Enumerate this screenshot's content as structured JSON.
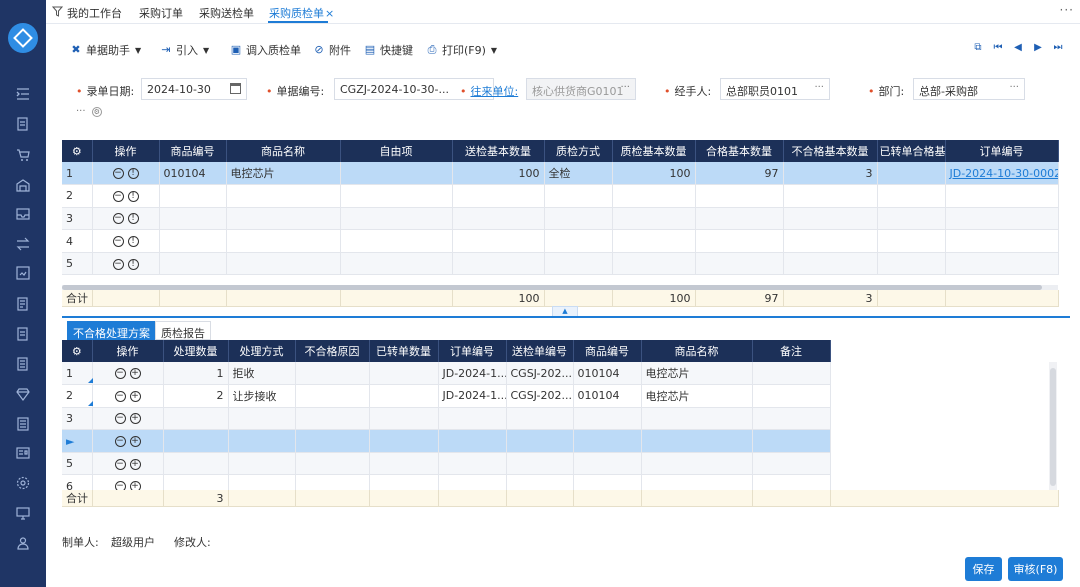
{
  "tabs": [
    {
      "label": "我的工作台"
    },
    {
      "label": "采购订单"
    },
    {
      "label": "采购送检单"
    },
    {
      "label": "采购质检单"
    }
  ],
  "tab_close": "×",
  "more": "···",
  "toolbar": {
    "assistant": "单据助手",
    "import": "引入",
    "import_qc": "调入质检单",
    "attachment": "附件",
    "shortcut": "快捷键",
    "print": "打印(F9)"
  },
  "form": {
    "entry_date_label": "录单日期:",
    "entry_date": "2024-10-30",
    "doc_no_label": "单据编号:",
    "doc_no": "CGZJ-2024-10-30-...",
    "partner_label": "往来单位:",
    "partner": "核心供货商G0101",
    "handler_label": "经手人:",
    "handler": "总部职员0101",
    "dept_label": "部门:",
    "dept": "总部-采购部",
    "dots": "···"
  },
  "main_grid": {
    "headers": [
      "操作",
      "商品编号",
      "商品名称",
      "自由项",
      "送检基本数量",
      "质检方式",
      "质检基本数量",
      "合格基本数量",
      "不合格基本数量",
      "已转单合格基",
      "订单编号"
    ],
    "rows": [
      {
        "no": "1",
        "code": "010104",
        "name": "电控芯片",
        "free": "",
        "send_qty": "100",
        "method": "全检",
        "qc_qty": "100",
        "ok_qty": "97",
        "ng_qty": "3",
        "transferred": "",
        "order_no": "JD-2024-10-30-0002"
      },
      {
        "no": "2"
      },
      {
        "no": "3"
      },
      {
        "no": "4"
      },
      {
        "no": "5"
      }
    ],
    "total": {
      "label": "合计",
      "send_qty": "100",
      "qc_qty": "100",
      "ok_qty": "97",
      "ng_qty": "3"
    }
  },
  "subtabs": [
    "不合格处理方案",
    "质检报告"
  ],
  "sub_grid": {
    "headers": [
      "操作",
      "处理数量",
      "处理方式",
      "不合格原因",
      "已转单数量",
      "订单编号",
      "送检单编号",
      "商品编号",
      "商品名称",
      "备注"
    ],
    "rows": [
      {
        "no": "1",
        "qty": "1",
        "method": "拒收",
        "reason": "",
        "transferred": "",
        "order_no": "JD-2024-1...",
        "send_no": "CGSJ-202...",
        "code": "010104",
        "name": "电控芯片",
        "remark": ""
      },
      {
        "no": "2",
        "qty": "2",
        "method": "让步接收",
        "reason": "",
        "transferred": "",
        "order_no": "JD-2024-1...",
        "send_no": "CGSJ-202...",
        "code": "010104",
        "name": "电控芯片",
        "remark": ""
      },
      {
        "no": "3"
      },
      {
        "no": "►"
      },
      {
        "no": "5"
      },
      {
        "no": "6"
      }
    ],
    "total": {
      "label": "合计",
      "qty": "3"
    }
  },
  "footer": {
    "creator_label": "制单人:",
    "creator": "超级用户",
    "modifier_label": "修改人:",
    "save": "保存",
    "audit": "审核(F8)"
  },
  "colors": {
    "accent": "#1e7cd6",
    "sidebar": "#1f3565",
    "grid_header": "#1c3058",
    "selected_row": "#bcdaf7"
  }
}
